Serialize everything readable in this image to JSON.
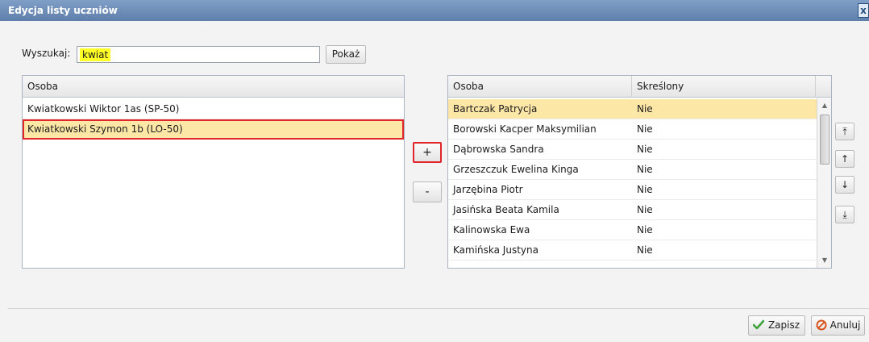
{
  "window": {
    "title": "Edycja listy uczniów",
    "close_label": "x"
  },
  "search": {
    "label": "Wyszukaj:",
    "value": "kwiat",
    "button": "Pokaż"
  },
  "left_grid": {
    "header": "Osoba",
    "rows": [
      "Kwiatkowski Wiktor 1as (SP-50)",
      "Kwiatkowski Szymon 1b (LO-50)"
    ],
    "selected_index": 1
  },
  "mid_buttons": {
    "add": "+",
    "remove": "-"
  },
  "right_grid": {
    "headers": [
      "Osoba",
      "Skreślony"
    ],
    "rows": [
      [
        "Bartczak Patrycja",
        "Nie"
      ],
      [
        "Borowski Kacper Maksymilian",
        "Nie"
      ],
      [
        "Dąbrowska Sandra",
        "Nie"
      ],
      [
        "Grzeszczuk Ewelina Kinga",
        "Nie"
      ],
      [
        "Jarzębina Piotr",
        "Nie"
      ],
      [
        "Jasińska Beata Kamila",
        "Nie"
      ],
      [
        "Kalinowska Ewa",
        "Nie"
      ],
      [
        "Kamińska Justyna",
        "Nie"
      ]
    ],
    "selected_index": 0
  },
  "move_buttons": {
    "top": "⤒",
    "up": "↑",
    "down": "↓",
    "bottom": "⤓"
  },
  "footer": {
    "save": "Zapisz",
    "cancel": "Anuluj"
  },
  "colors": {
    "title_bar": "#6f8fba",
    "selected_row": "#fde7a7",
    "highlight": "#ffff27",
    "outline": "#e0252b"
  }
}
